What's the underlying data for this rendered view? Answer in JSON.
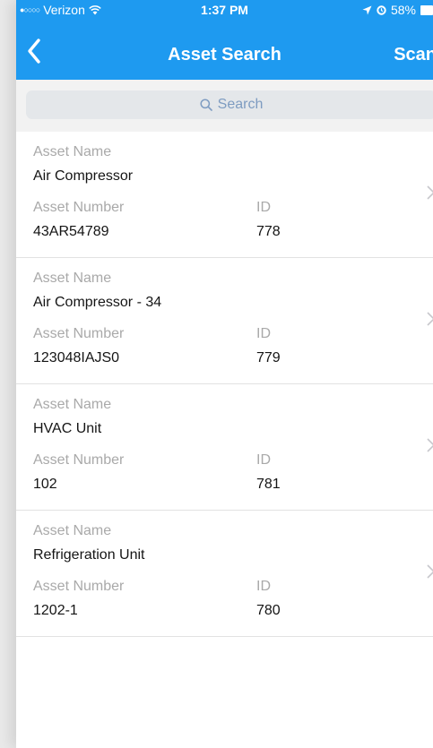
{
  "status_bar": {
    "carrier": "Verizon",
    "time": "1:37 PM",
    "battery": "58%"
  },
  "nav": {
    "title": "Asset Search",
    "scan_label": "Scan"
  },
  "search": {
    "placeholder": "Search"
  },
  "labels": {
    "asset_name": "Asset Name",
    "asset_number": "Asset Number",
    "id": "ID"
  },
  "assets": [
    {
      "name": "Air Compressor",
      "number": "43AR54789",
      "id": "778"
    },
    {
      "name": "Air Compressor - 34",
      "number": "123048IAJS0",
      "id": "779"
    },
    {
      "name": "HVAC Unit",
      "number": "102",
      "id": "781"
    },
    {
      "name": "Refrigeration Unit",
      "number": "1202-1",
      "id": "780"
    }
  ],
  "colors": {
    "accent": "#1e9af0",
    "search_placeholder": "#7e9cc1",
    "label_gray": "#a9a9a9"
  }
}
